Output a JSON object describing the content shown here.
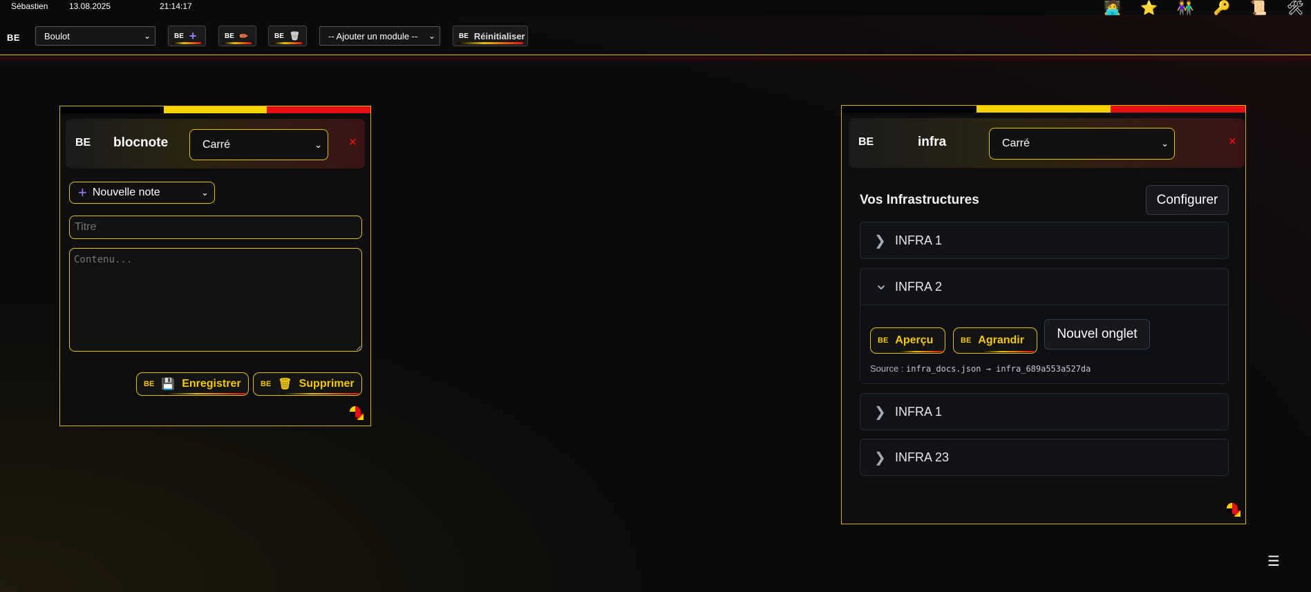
{
  "infobar": {
    "user": "Sébastien",
    "date": "13.08.2025",
    "time": "21:14:17",
    "icons": [
      "user-icon",
      "star-icon",
      "people-icon",
      "key-icon",
      "scroll-icon",
      "tools-icon"
    ]
  },
  "toolbar": {
    "logo": "BE",
    "workspace_value": "Boulot",
    "add_icon": "+",
    "edit_icon": "✏",
    "delete_icon": "🗑",
    "add_module_value": "-- Ajouter un module --",
    "reset_label": "Réinitialiser",
    "be": "BE"
  },
  "colors": {
    "accent_yellow": "#e6c200",
    "accent_red": "#e61010",
    "flag": [
      "#000000",
      "#f5d400",
      "#e61010"
    ]
  },
  "blocnote": {
    "logo": "BE",
    "title": "blocnote",
    "shape_value": "Carré",
    "close": "×",
    "new_note_value": "Nouvelle note",
    "new_note_icon": "+",
    "title_placeholder": "Titre",
    "content_placeholder": "Contenu...",
    "save_label": "Enregistrer",
    "save_icon": "💾",
    "delete_label": "Supprimer",
    "delete_icon": "🗑",
    "be": "BE"
  },
  "infra": {
    "logo": "BE",
    "title": "infra",
    "shape_value": "Carré",
    "close": "×",
    "section_title": "Vos Infrastructures",
    "configure_label": "Configurer",
    "items": [
      {
        "label": "INFRA 1",
        "arrow": "❯"
      },
      {
        "label": "INFRA 2",
        "arrow": "⌄"
      },
      {
        "label": "INFRA 1",
        "arrow": "❯"
      },
      {
        "label": "INFRA 23",
        "arrow": "❯"
      }
    ],
    "preview_label": "Aperçu",
    "expand_label": "Agrandir",
    "new_tab_label": "Nouvel onglet",
    "source_label": "Source :",
    "source_value": "infra_docs.json → infra_689a553a527da",
    "be": "BE"
  },
  "menu_icon": "☰"
}
